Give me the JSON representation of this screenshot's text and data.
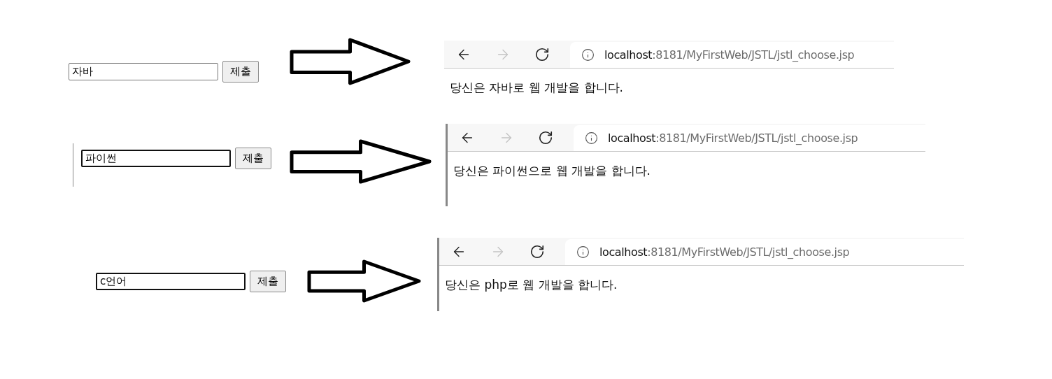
{
  "rows": [
    {
      "input": {
        "value": "자바",
        "focused": false
      },
      "submit": "제출",
      "browser": {
        "back_disabled": false,
        "forward_disabled": true,
        "host": "localhost",
        "path": ":8181/MyFirstWeb/JSTL/jstl_choose.jsp",
        "message": "당신은 자바로 웹 개발을 합니다."
      }
    },
    {
      "input": {
        "value": "파이썬",
        "focused": true
      },
      "submit": "제출",
      "browser": {
        "back_disabled": false,
        "forward_disabled": true,
        "host": "localhost",
        "path": ":8181/MyFirstWeb/JSTL/jstl_choose.jsp",
        "message": "당신은 파이썬으로 웹 개발을 합니다."
      }
    },
    {
      "input": {
        "value": "c언어",
        "focused": true
      },
      "submit": "제출",
      "browser": {
        "back_disabled": false,
        "forward_disabled": true,
        "host": "localhost",
        "path": ":8181/MyFirstWeb/JSTL/jstl_choose.jsp",
        "message": "당신은 php로 웹 개발을 합니다."
      }
    }
  ]
}
